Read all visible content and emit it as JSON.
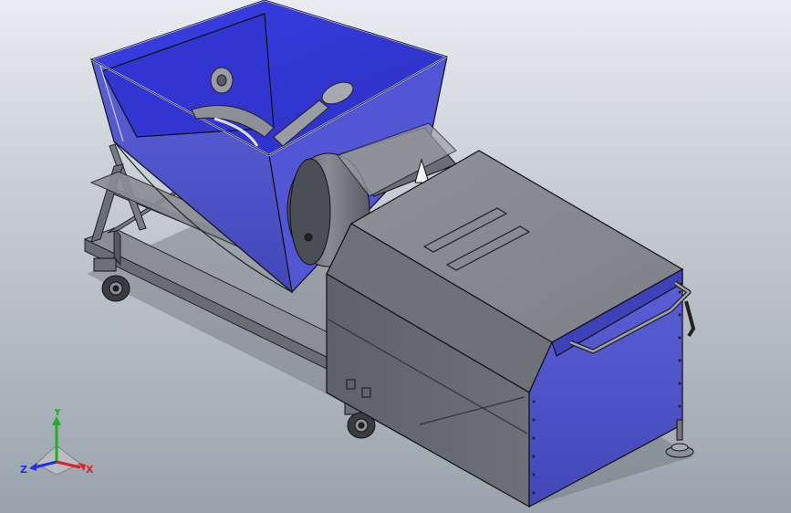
{
  "view": {
    "background_top": "#e9ecf0",
    "background_bottom": "#9aa3ad",
    "accent_blue": "#4a4fd0",
    "steel_gray": "#7b7e86"
  },
  "triad": {
    "x_label": "X",
    "y_label": "Y",
    "z_label": "Z",
    "x_color": "#e02020",
    "y_color": "#20b020",
    "z_color": "#2030e0"
  }
}
